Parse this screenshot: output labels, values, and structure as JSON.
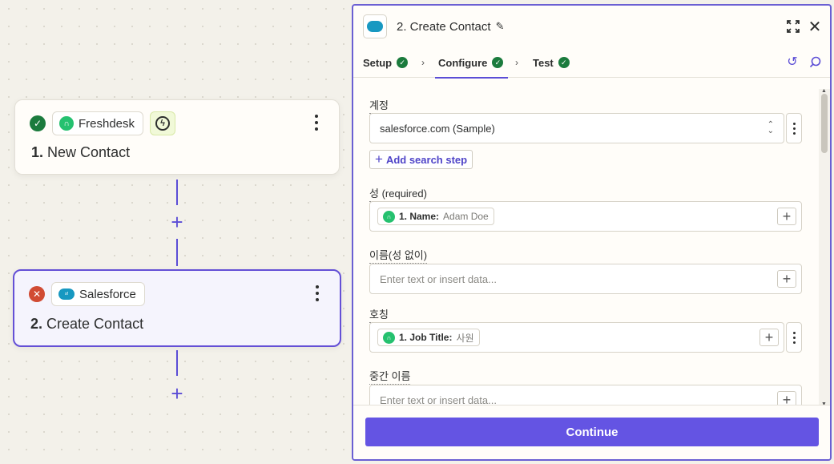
{
  "canvas": {
    "trigger": {
      "app_name": "Freshdesk",
      "step_number": "1.",
      "step_title": "New Contact",
      "status": "ok"
    },
    "action": {
      "app_name": "Salesforce",
      "step_number": "2.",
      "step_title": "Create Contact",
      "status": "error"
    }
  },
  "panel": {
    "title": "2. Create Contact",
    "tabs": [
      {
        "label": "Setup",
        "status": "ok"
      },
      {
        "label": "Configure",
        "status": "ok"
      },
      {
        "label": "Test",
        "status": "ok"
      }
    ],
    "fields": {
      "account": {
        "label": "계정",
        "value": "salesforce.com (Sample)"
      },
      "add_search_step_label": "Add search step",
      "last_name": {
        "label": "성 (required)",
        "pill_key": "1. Name:",
        "pill_value": "Adam Doe"
      },
      "first_name": {
        "label": "이름(성 없이)",
        "placeholder": "Enter text or insert data..."
      },
      "salutation": {
        "label": "호칭",
        "pill_key": "1. Job Title:",
        "pill_value": "사원"
      },
      "middle_name": {
        "label": "중간 이름",
        "placeholder": "Enter text or insert data..."
      }
    },
    "continue_label": "Continue"
  },
  "colors": {
    "accent": "#6454e3",
    "success": "#1b7b3d",
    "error": "#d14b33",
    "freshdesk": "#25c16f",
    "salesforce": "#1798c1"
  }
}
